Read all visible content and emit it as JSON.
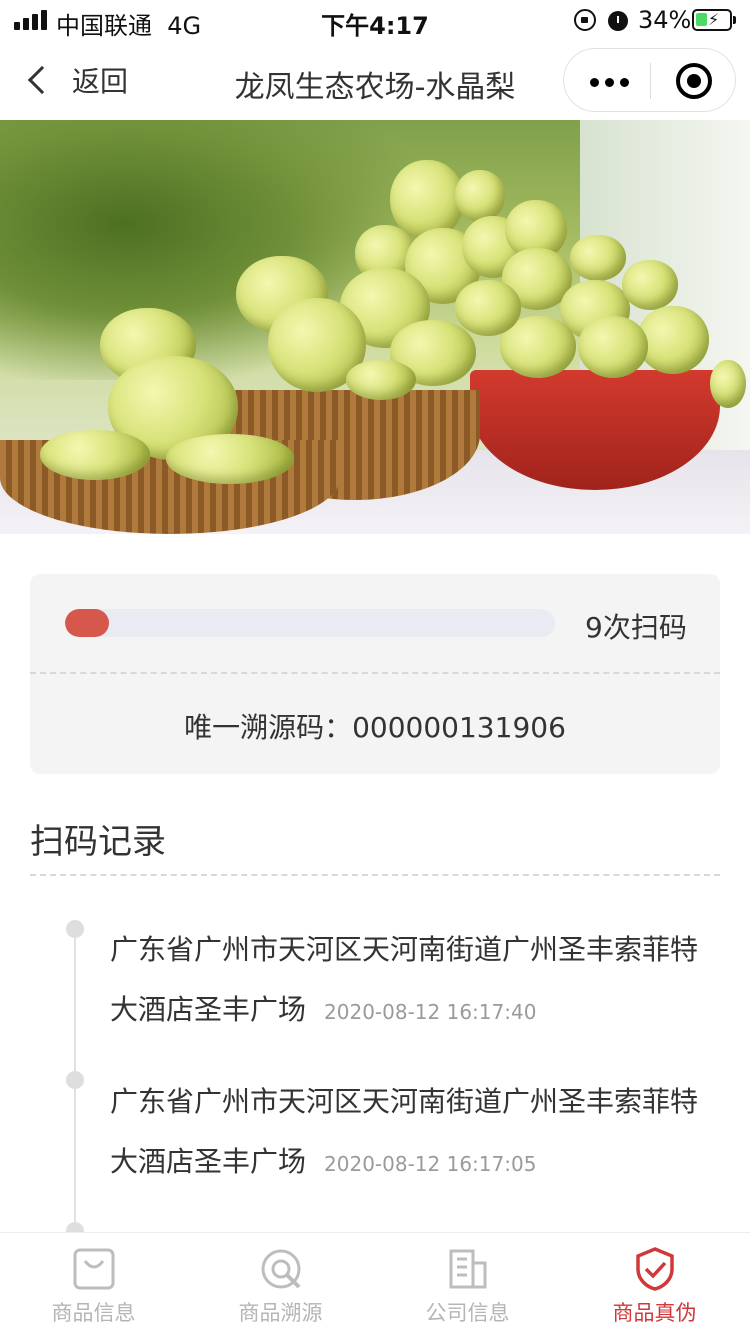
{
  "status_bar": {
    "carrier": "中国联通",
    "network": "4G",
    "time": "下午4:17",
    "battery_percent": "34%",
    "battery_level": 0.34
  },
  "nav": {
    "back_label": "返回",
    "title": "龙凤生态农场-水晶梨"
  },
  "scan_info": {
    "count_label": "9次扫码",
    "progress_fraction": 0.09,
    "trace_code_label": "唯一溯源码：000000131906"
  },
  "records": {
    "title": "扫码记录",
    "items": [
      {
        "address": "广东省广州市天河区天河南街道广州圣丰索菲特大酒店圣丰广场",
        "time": "2020-08-12 16:17:40"
      },
      {
        "address": "广东省广州市天河区天河南街道广州圣丰索菲特大酒店圣丰广场",
        "time": "2020-08-12 16:17:05"
      }
    ]
  },
  "tabs": [
    {
      "label": "商品信息",
      "icon": "shopping-bag-icon",
      "active": false
    },
    {
      "label": "商品溯源",
      "icon": "trace-search-icon",
      "active": false
    },
    {
      "label": "公司信息",
      "icon": "building-icon",
      "active": false
    },
    {
      "label": "商品真伪",
      "icon": "shield-check-icon",
      "active": true
    }
  ],
  "colors": {
    "accent_red": "#d0383a",
    "progress_fill": "#d6574b",
    "inactive_tab": "#b5b5b5"
  }
}
